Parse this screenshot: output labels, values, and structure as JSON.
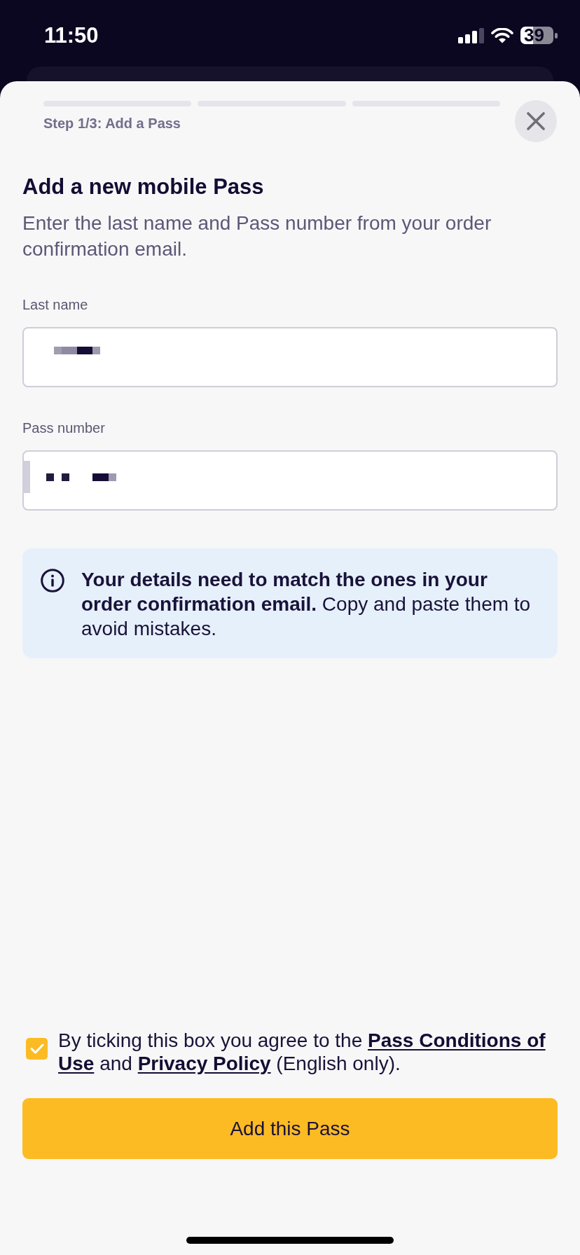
{
  "status_bar": {
    "time": "11:50",
    "battery": "39"
  },
  "header": {
    "progress_segments": [
      {
        "filled": false
      },
      {
        "filled": false
      },
      {
        "filled": false
      }
    ],
    "step_label": "Step 1/3: Add a Pass"
  },
  "title": "Add a new mobile Pass",
  "description": "Enter the last name and Pass number from your order confirmation email.",
  "fields": [
    {
      "label": "Last name",
      "redacted": true
    },
    {
      "label": "Pass number",
      "redacted": true
    }
  ],
  "info": {
    "text": "**Your details need to match the ones in your order confirmation email.** Copy and paste them to avoid mistakes."
  },
  "consent": {
    "checked": true,
    "segments": [
      {
        "kind": "text",
        "text": "By ticking this box you agree to the"
      },
      {
        "kind": "link",
        "text": "Pass Conditions of"
      },
      {
        "kind": "link",
        "text": "Use"
      },
      {
        "kind": "text",
        "text": "and"
      },
      {
        "kind": "link",
        "text": "Privacy Policy"
      },
      {
        "kind": "text",
        "text": "(English only)."
      }
    ]
  },
  "primary_button": {
    "label": "Add this Pass"
  }
}
